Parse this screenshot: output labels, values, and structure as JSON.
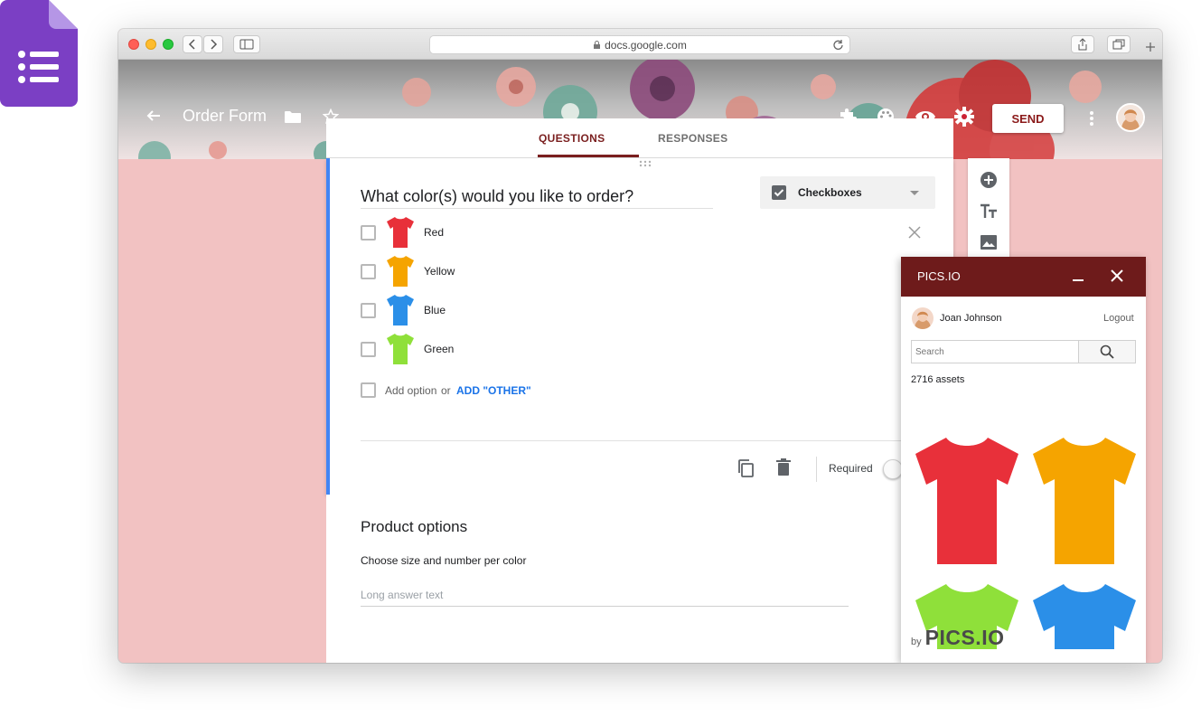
{
  "browser": {
    "address": "docs.google.com"
  },
  "header": {
    "form_title": "Order Form",
    "send_label": "SEND"
  },
  "tabs": [
    {
      "label": "QUESTIONS",
      "active": true
    },
    {
      "label": "RESPONSES",
      "active": false
    }
  ],
  "question": {
    "title": "What color(s) would you like to order?",
    "type_label": "Checkboxes",
    "options": [
      {
        "label": "Red",
        "color": "#e8303a"
      },
      {
        "label": "Yellow",
        "color": "#f5a400"
      },
      {
        "label": "Blue",
        "color": "#2b8fe8"
      },
      {
        "label": "Green",
        "color": "#8fe03a"
      }
    ],
    "add_option_label": "Add option",
    "or_label": "or",
    "add_other_label": "ADD \"OTHER\"",
    "required_label": "Required"
  },
  "section": {
    "title": "Product options",
    "description": "Choose size and number per color",
    "answer_placeholder": "Long answer text"
  },
  "pics_panel": {
    "title": "PICS.IO",
    "user_name": "Joan Johnson",
    "logout_label": "Logout",
    "search_placeholder": "Search",
    "asset_count": "2716 assets",
    "assets": [
      {
        "color": "#e8303a"
      },
      {
        "color": "#f5a400"
      },
      {
        "color": "#8fe03a"
      },
      {
        "color": "#2b8fe8"
      }
    ],
    "brand_by": "by",
    "brand_name": "PICS.IO"
  },
  "colors": {
    "accent": "#7a1f1f",
    "pics_header": "#6e1b1b",
    "page_background": "#f2c2c2",
    "question_focus": "#4285f4",
    "link": "#1a73e8"
  }
}
